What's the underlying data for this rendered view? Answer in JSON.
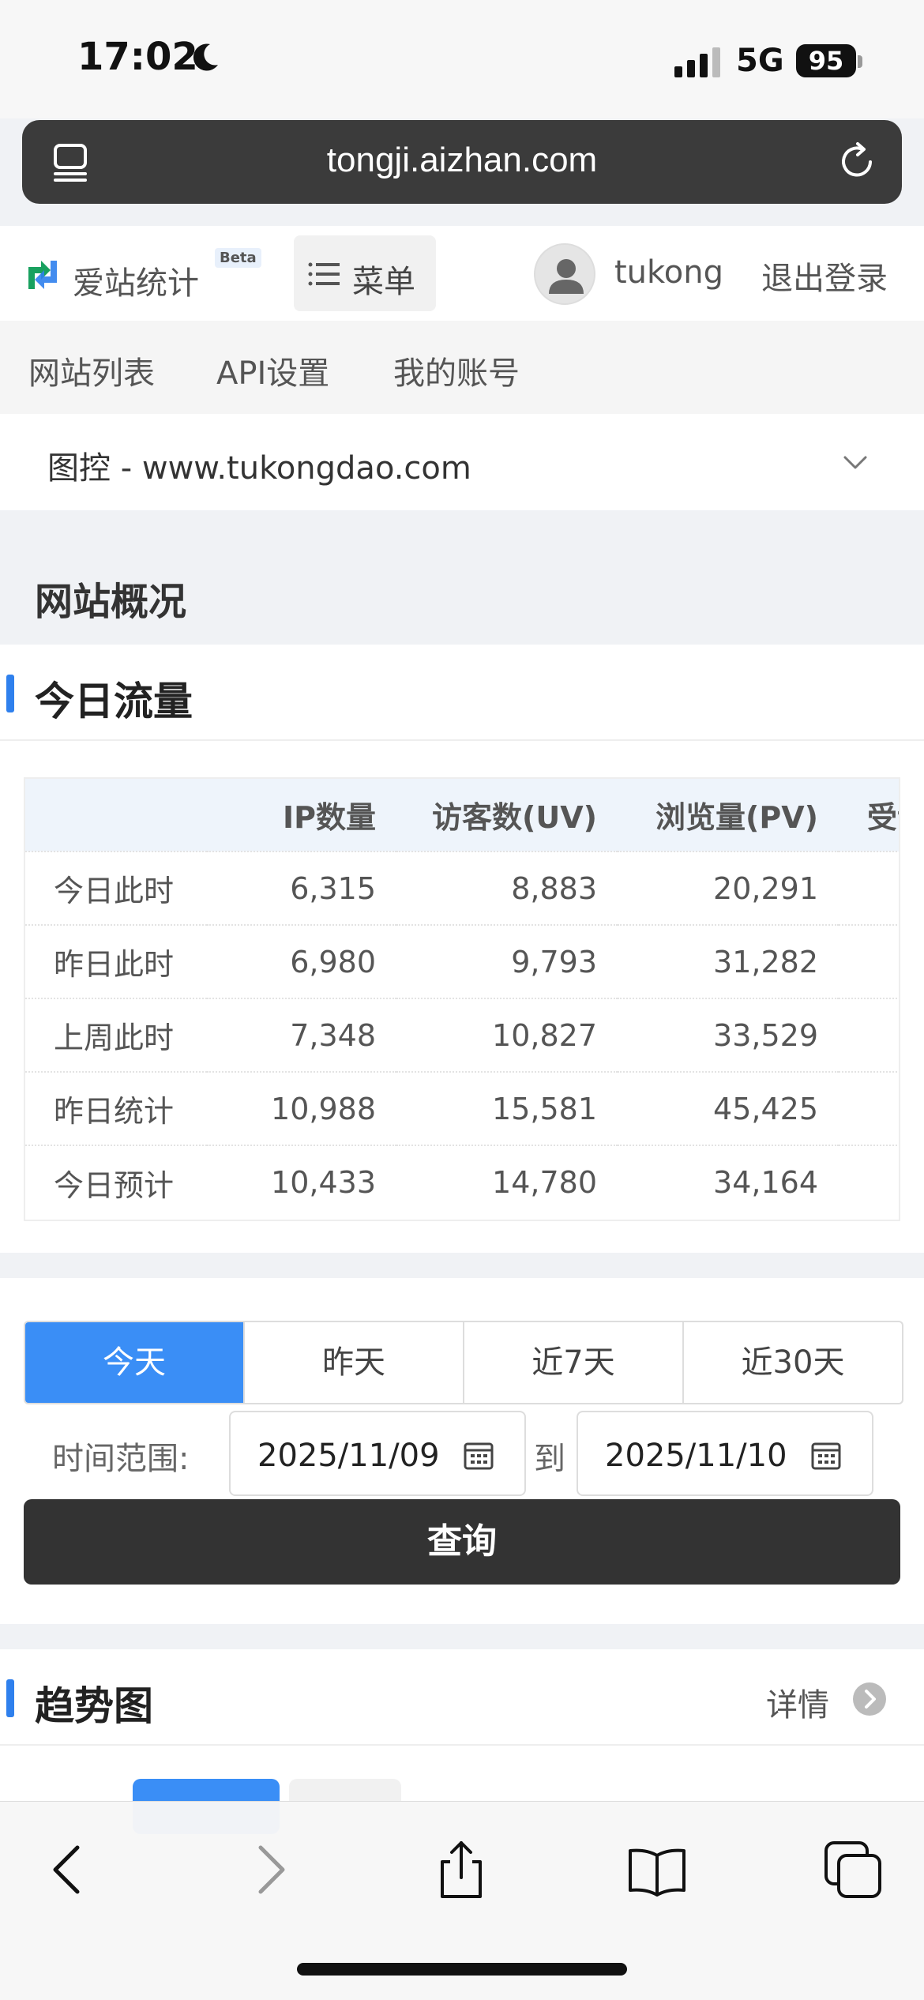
{
  "status_bar": {
    "time": "17:02",
    "network": "5G",
    "battery": "95"
  },
  "browser": {
    "url": "tongji.aizhan.com"
  },
  "header": {
    "logo_text": "爱站统计",
    "beta_badge": "Beta",
    "menu_label": "菜单",
    "username": "tukong",
    "logout_label": "退出登录"
  },
  "subnav": {
    "items": [
      "网站列表",
      "API设置",
      "我的账号"
    ]
  },
  "site_selector": {
    "value": "图控 - www.tukongdao.com"
  },
  "page": {
    "title": "网站概况"
  },
  "today_traffic": {
    "title": "今日流量",
    "columns": [
      "",
      "IP数量",
      "访客数(UV)",
      "浏览量(PV)",
      "受访"
    ],
    "rows": [
      {
        "label": "今日此时",
        "ip": "6,315",
        "uv": "8,883",
        "pv": "20,291"
      },
      {
        "label": "昨日此时",
        "ip": "6,980",
        "uv": "9,793",
        "pv": "31,282"
      },
      {
        "label": "上周此时",
        "ip": "7,348",
        "uv": "10,827",
        "pv": "33,529"
      },
      {
        "label": "昨日统计",
        "ip": "10,988",
        "uv": "15,581",
        "pv": "45,425"
      },
      {
        "label": "今日预计",
        "ip": "10,433",
        "uv": "14,780",
        "pv": "34,164"
      }
    ]
  },
  "date_filter": {
    "tabs": [
      "今天",
      "昨天",
      "近7天",
      "近30天"
    ],
    "active_tab": "今天",
    "range_label": "时间范围:",
    "start_date": "2025/11/09",
    "to_label": "到",
    "end_date": "2025/11/10",
    "query_label": "查询"
  },
  "trend": {
    "title": "趋势图",
    "detail_label": "详情"
  },
  "colors": {
    "accent": "#3a8ef6",
    "section_bar": "#2f80ed",
    "query_button": "#333333"
  }
}
